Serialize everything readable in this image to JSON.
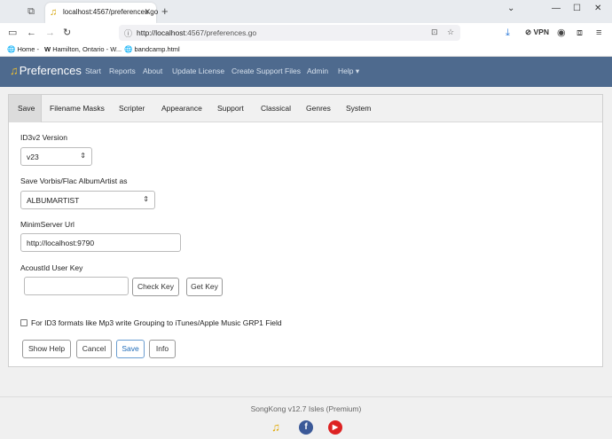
{
  "browser": {
    "tab_title": "localhost:4567/preferences.go",
    "url_host": "http://localhost",
    "url_path": ":4567/preferences.go",
    "vpn_label": "VPN",
    "bookmarks": [
      "Home -",
      "Hamilton, Ontario - W...",
      "bandcamp.html"
    ]
  },
  "navbar": {
    "brand": "Preferences",
    "links": [
      "Start",
      "Reports",
      "About",
      "Update License",
      "Create Support Files",
      "Admin",
      "Help"
    ]
  },
  "tabs": [
    "Save",
    "Filename Masks",
    "Scripter",
    "Appearance",
    "Support",
    "Classical",
    "Genres",
    "System"
  ],
  "form": {
    "id3_label": "ID3v2 Version",
    "id3_value": "v23",
    "vorbis_label": "Save Vorbis/Flac AlbumArtist as",
    "vorbis_value": "ALBUMARTIST",
    "minim_label": "MinimServer Url",
    "minim_value": "http://localhost:9790",
    "acoustid_label": "AcoustId User Key",
    "acoustid_value": "",
    "check_key": "Check Key",
    "get_key": "Get Key",
    "grouping_label": "For ID3 formats like Mp3 write Grouping to iTunes/Apple Music GRP1 Field"
  },
  "buttons": {
    "show_help": "Show Help",
    "cancel": "Cancel",
    "save": "Save",
    "info": "Info"
  },
  "footer": {
    "version": "SongKong v12.7 Isles (Premium)"
  },
  "colors": {
    "navbar": "#4e6a8e",
    "primary": "#1f6bb8"
  }
}
